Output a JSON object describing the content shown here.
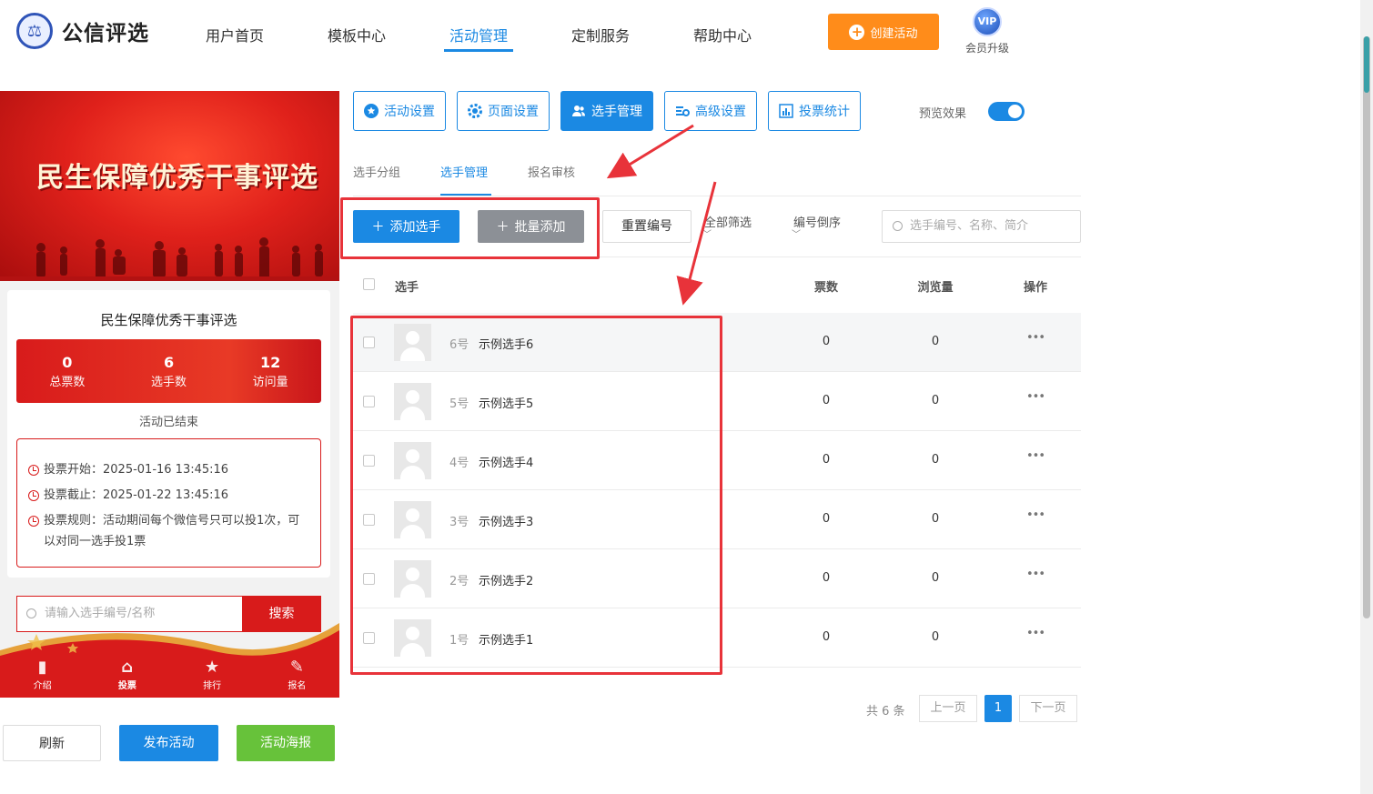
{
  "header": {
    "logo_text": "公信评选",
    "nav": [
      "用户首页",
      "模板中心",
      "活动管理",
      "定制服务",
      "帮助中心"
    ],
    "active_nav": "活动管理",
    "create_button": "创建活动",
    "vip_badge": "VIP",
    "vip_label": "会员升级"
  },
  "preview": {
    "banner_title": "民生保障优秀干事评选",
    "card_title": "民生保障优秀干事评选",
    "stats": [
      {
        "value": "0",
        "label": "总票数"
      },
      {
        "value": "6",
        "label": "选手数"
      },
      {
        "value": "12",
        "label": "访问量"
      }
    ],
    "status": "活动已结束",
    "info": [
      "投票开始：2025-01-16 13:45:16",
      "投票截止：2025-01-22 13:45:16",
      "投票规则：活动期间每个微信号只可以投1次，可以对同一选手投1票"
    ],
    "search_placeholder": "请输入选手编号/名称",
    "search_button": "搜索",
    "tabs": [
      {
        "label": "介绍",
        "icon": "book-icon"
      },
      {
        "label": "投票",
        "icon": "home-icon"
      },
      {
        "label": "排行",
        "icon": "medal-icon"
      },
      {
        "label": "报名",
        "icon": "edit-icon"
      }
    ],
    "active_tab": "投票"
  },
  "left_buttons": {
    "refresh": "刷新",
    "publish": "发布活动",
    "poster": "活动海报"
  },
  "toolbar": {
    "buttons": [
      "活动设置",
      "页面设置",
      "选手管理",
      "高级设置",
      "投票统计"
    ],
    "active": "选手管理",
    "preview_label": "预览效果",
    "preview_on": true
  },
  "subtabs": [
    "选手分组",
    "选手管理",
    "报名审核"
  ],
  "active_subtab": "选手管理",
  "actions": {
    "add": "添加选手",
    "batch_add": "批量添加",
    "reset_number": "重置编号",
    "filter_all": "全部筛选",
    "sort_desc": "编号倒序",
    "search_placeholder": "选手编号、名称、简介"
  },
  "table": {
    "headers": [
      "选手",
      "票数",
      "浏览量",
      "操作"
    ],
    "rows": [
      {
        "num": "6号",
        "name": "示例选手6",
        "votes": "0",
        "views": "0"
      },
      {
        "num": "5号",
        "name": "示例选手5",
        "votes": "0",
        "views": "0"
      },
      {
        "num": "4号",
        "name": "示例选手4",
        "votes": "0",
        "views": "0"
      },
      {
        "num": "3号",
        "name": "示例选手3",
        "votes": "0",
        "views": "0"
      },
      {
        "num": "2号",
        "name": "示例选手2",
        "votes": "0",
        "views": "0"
      },
      {
        "num": "1号",
        "name": "示例选手1",
        "votes": "0",
        "views": "0"
      }
    ],
    "more_symbol": "•••"
  },
  "pagination": {
    "total": "共 6 条",
    "prev": "上一页",
    "current": "1",
    "next": "下一页"
  },
  "colors": {
    "primary": "#1b89e3",
    "orange": "#ff8c1a",
    "red": "#d81b1b",
    "annotation": "#e8333a",
    "green": "#67c23a",
    "gray_button": "#8c9096"
  }
}
